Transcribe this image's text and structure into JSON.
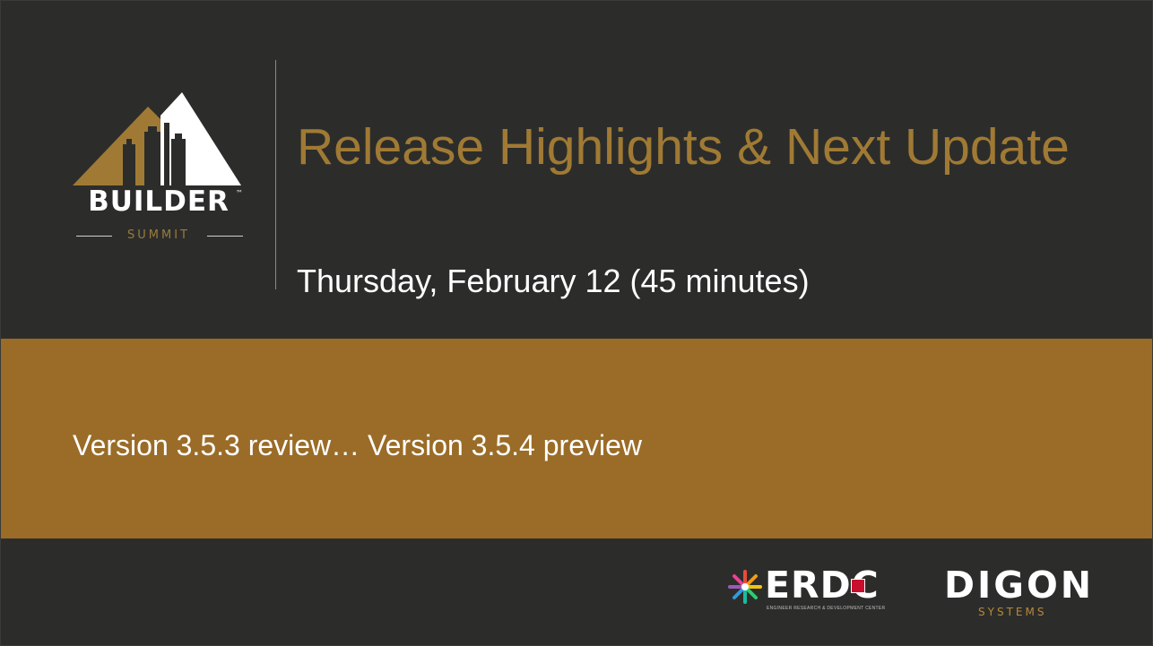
{
  "slide": {
    "title": "Release Highlights & Next Update",
    "subtitle": "Thursday, February 12 (45 minutes)",
    "band_text": "Version 3.5.3 review… Version 3.5.4 preview"
  },
  "logo": {
    "word": "BUILDER",
    "tm": "™",
    "sub": "SUMMIT",
    "icon": "mountain-city-logo"
  },
  "partners": {
    "erdc": {
      "word": "ERDC",
      "sub": "ENGINEER RESEARCH & DEVELOPMENT CENTER",
      "icon": "starburst-logo"
    },
    "digon": {
      "word": "DIGON",
      "sub": "SYSTEMS"
    }
  },
  "colors": {
    "background": "#2c2d2b",
    "accent": "#a07a34",
    "band": "#9a6c28",
    "text": "#ffffff"
  }
}
